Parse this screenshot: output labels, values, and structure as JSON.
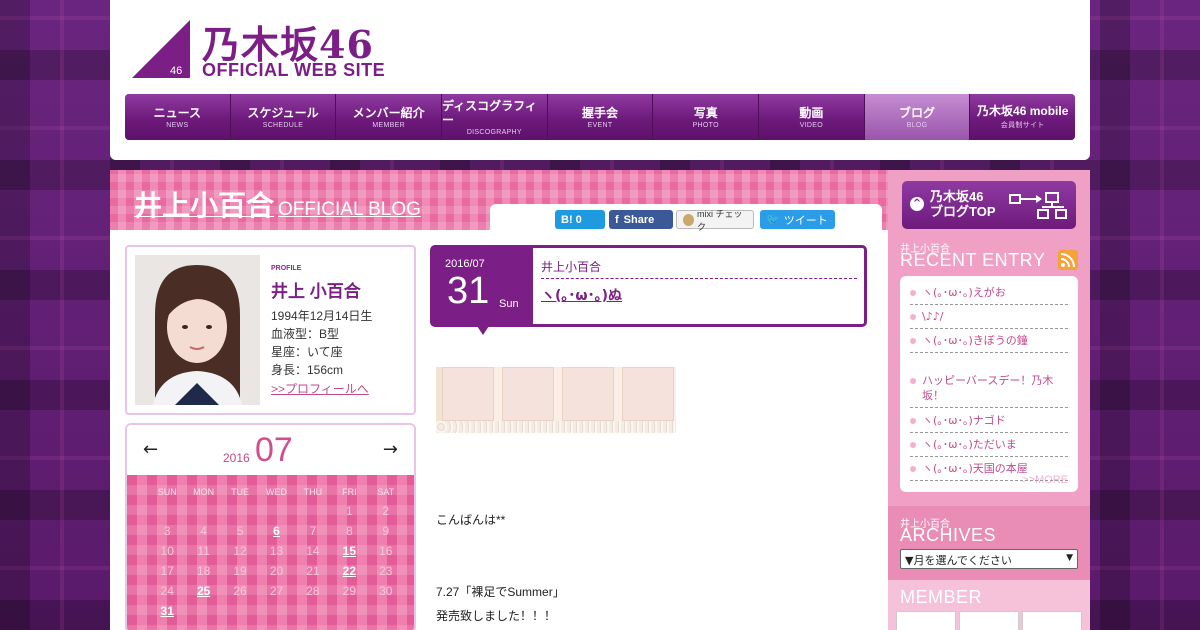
{
  "header": {
    "logo_number": "46",
    "logo_title": "乃木坂46",
    "logo_sub": "OFFICIAL WEB SITE"
  },
  "nav": [
    {
      "jp": "ニュース",
      "en": "NEWS"
    },
    {
      "jp": "スケジュール",
      "en": "SCHEDULE"
    },
    {
      "jp": "メンバー紹介",
      "en": "MEMBER"
    },
    {
      "jp": "ディスコグラフィー",
      "en": "DISCOGRAPHY"
    },
    {
      "jp": "握手会",
      "en": "EVENT"
    },
    {
      "jp": "写真",
      "en": "PHOTO"
    },
    {
      "jp": "動画",
      "en": "VIDEO"
    },
    {
      "jp": "ブログ",
      "en": "BLOG"
    },
    {
      "jp": "乃木坂46 mobile",
      "en": "会員制サイト"
    }
  ],
  "blog": {
    "name": "井上小百合",
    "suffix": "OFFICIAL BLOG"
  },
  "share": {
    "hatena": "B! 0",
    "facebook": "Share",
    "mixi": "mixi チェック",
    "twitter": "ツイート"
  },
  "profile": {
    "label": "PROFILE",
    "name": "井上 小百合",
    "birthday": "1994年12月14日生",
    "blood": "血液型：B型",
    "sign": "星座：いて座",
    "height": "身長：156cm",
    "link": ">>プロフィールへ"
  },
  "calendar": {
    "prev": "←",
    "next": "→",
    "year": "2016",
    "month": "07",
    "dow": [
      "SUN",
      "MON",
      "TUE",
      "WED",
      "THU",
      "FRI",
      "SAT"
    ],
    "days": [
      "",
      "",
      "",
      "",
      "",
      "1",
      "2",
      "3",
      "4",
      "5",
      "6",
      "7",
      "8",
      "9",
      "10",
      "11",
      "12",
      "13",
      "14",
      "15",
      "16",
      "17",
      "18",
      "19",
      "20",
      "21",
      "22",
      "23",
      "24",
      "25",
      "26",
      "27",
      "28",
      "29",
      "30",
      "31",
      "",
      "",
      "",
      "",
      "",
      ""
    ],
    "links": [
      "6",
      "15",
      "22",
      "25",
      "31"
    ]
  },
  "entry": {
    "year_month": "2016/07",
    "day": "31",
    "dow": "Sun",
    "author": "井上小百合",
    "title": "ヽ(｡･ω･｡)ぬ",
    "lines": [
      "こんばんは**",
      "7.27「裸足でSummer」",
      "発売致しました！！！"
    ]
  },
  "sidebar": {
    "top_button": "乃木坂46\nブログTOP",
    "recent_label": "井上小百合",
    "recent_heading": "RECENT ENTRY",
    "recent": [
      "ヽ(｡･ω･｡)えがお",
      "\\♪♪/",
      "ヽ(｡･ω･｡)きぼうの鐘",
      "ハッピーバースデー！乃木坂！",
      "ヽ(｡･ω･｡)ナゴド",
      "ヽ(｡･ω･｡)ただいま",
      "ヽ(｡･ω･｡)天国の本屋"
    ],
    "more": ">>MORE",
    "archive_label": "井上小百合",
    "archive_heading": "ARCHIVES",
    "archive_select": "▼月を選んでください",
    "member_heading": "MEMBER"
  },
  "colors": {
    "brand": "#7b1f86",
    "pink": "#e86aa0",
    "link": "#c24a8a"
  }
}
